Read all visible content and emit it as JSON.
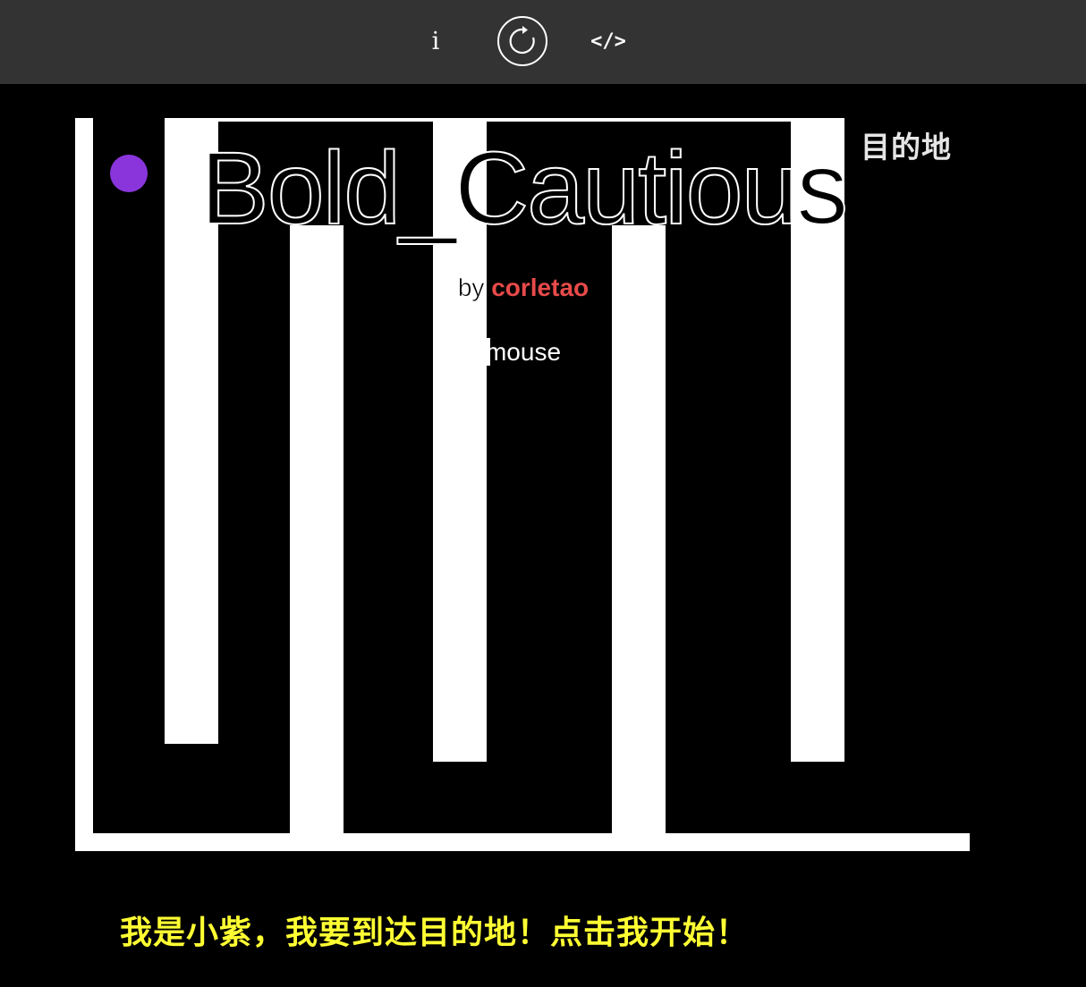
{
  "toolbar": {
    "info_label": "i",
    "code_label": "</>"
  },
  "game": {
    "title": "Bold_Cautious",
    "by_label": "by",
    "author": "corletao",
    "control": "mouse",
    "destination_label": "目的地",
    "prompt": "我是小紫，我要到达目的地！点击我开始！"
  },
  "colors": {
    "toolbar_bg": "#333333",
    "stage_bg": "#000000",
    "wall": "#ffffff",
    "player": "#8a35dc",
    "author": "#e84a4a",
    "prompt": "#ffff33"
  },
  "icons": [
    "info-icon",
    "restart-icon",
    "code-icon"
  ]
}
